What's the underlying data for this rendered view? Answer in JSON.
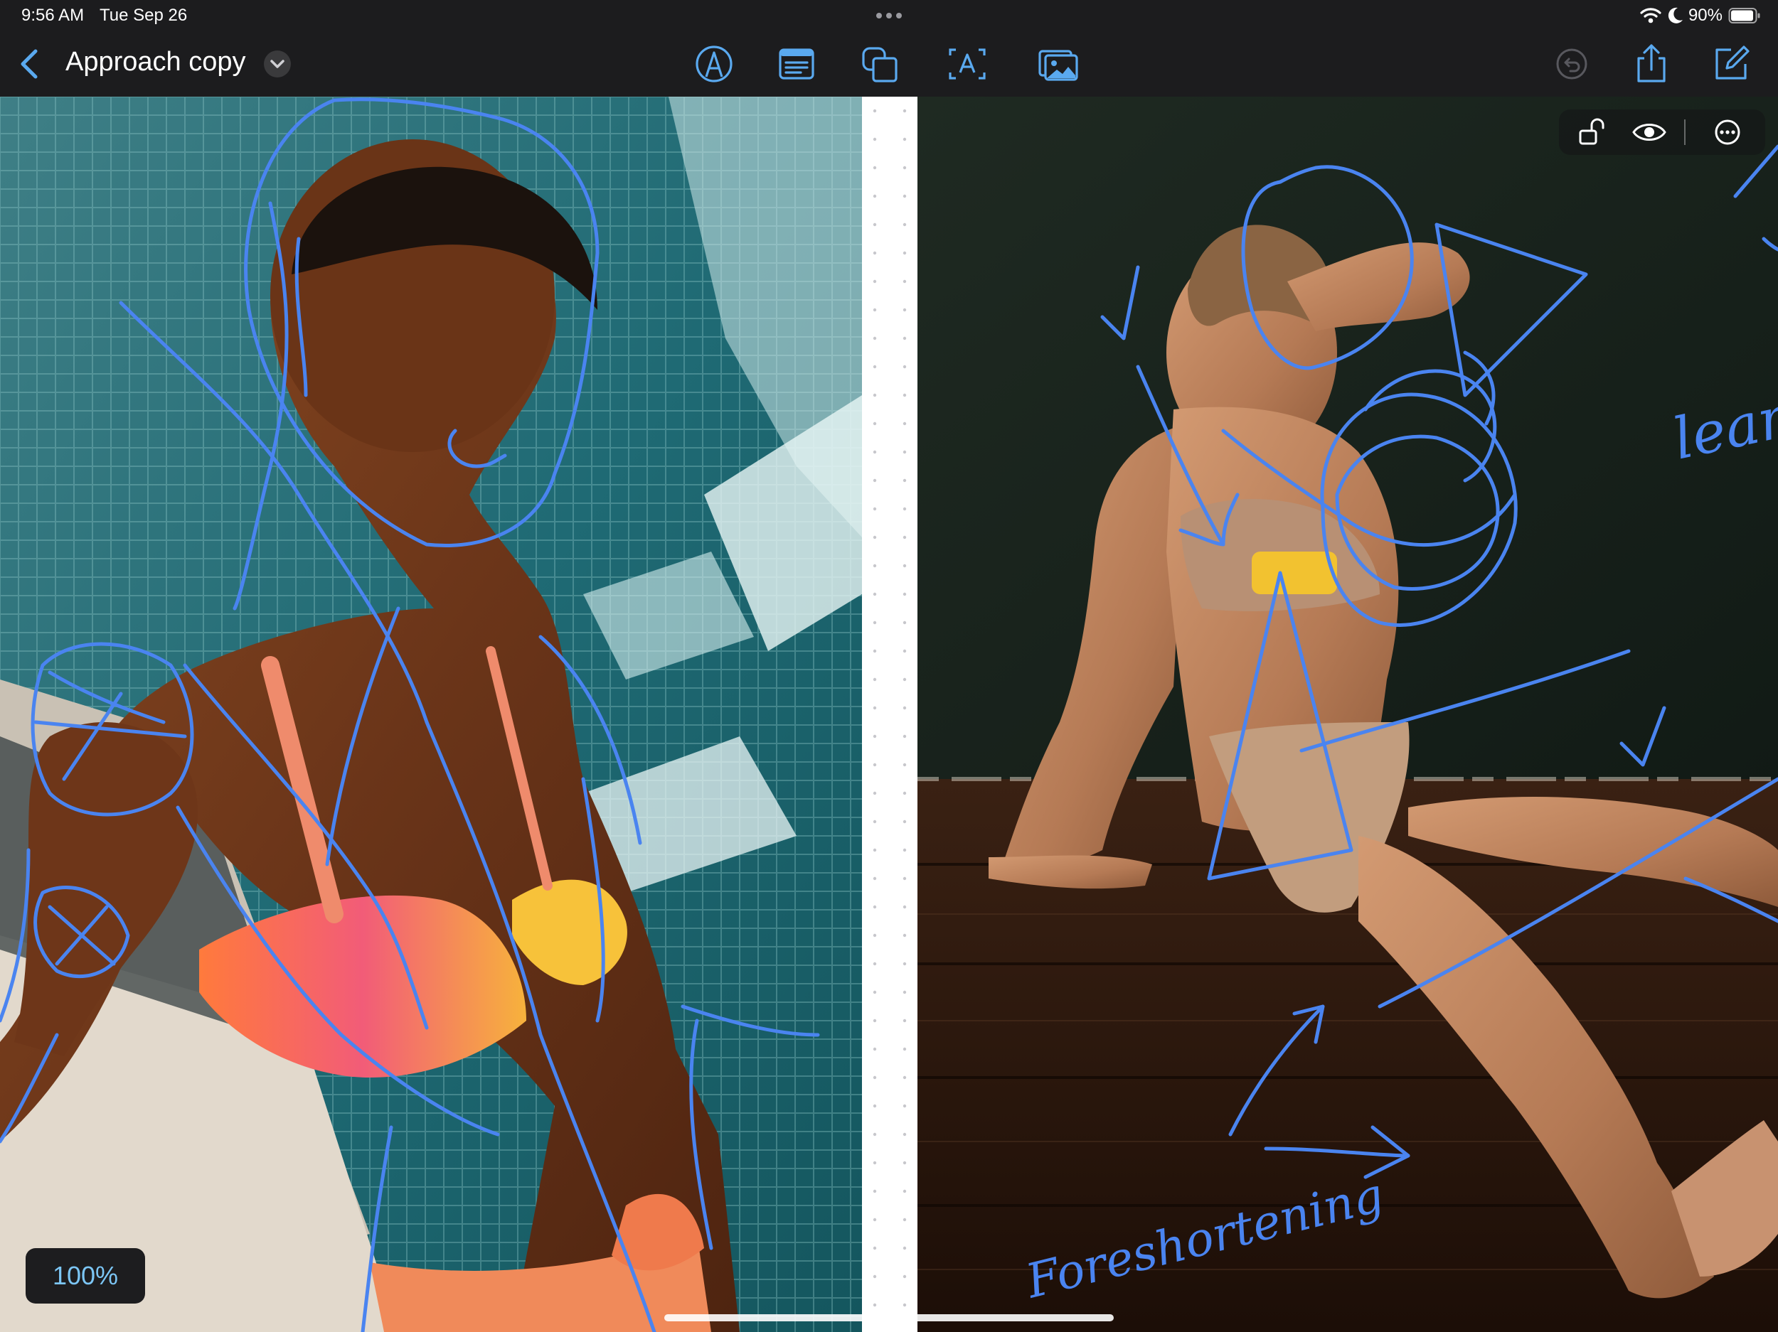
{
  "status_bar": {
    "time": "9:56 AM",
    "date": "Tue Sep 26",
    "battery": "90%",
    "icons": [
      "wifi-icon",
      "moon-icon",
      "battery-icon"
    ]
  },
  "toolbar": {
    "back_icon": "chevron-left-icon",
    "title": "Approach copy",
    "title_menu_icon": "chevron-down-icon",
    "tools": [
      "pen-tool-icon",
      "text-box-icon",
      "shapes-icon",
      "text-insert-icon",
      "image-insert-icon"
    ],
    "right_icons": [
      "undo-icon",
      "share-icon",
      "compose-icon"
    ]
  },
  "canvas_controls": {
    "icons": [
      "unlock-icon",
      "eye-icon",
      "more-icon"
    ]
  },
  "annotations": {
    "word_left": "lean",
    "phrase": "Foreshortening"
  },
  "zoom": {
    "label": "100%"
  },
  "colors": {
    "accent": "#4a84f0",
    "toolbar_bg": "#1c1c1e",
    "icon_blue": "#5aa9ef",
    "highlight": "#f2c230"
  }
}
